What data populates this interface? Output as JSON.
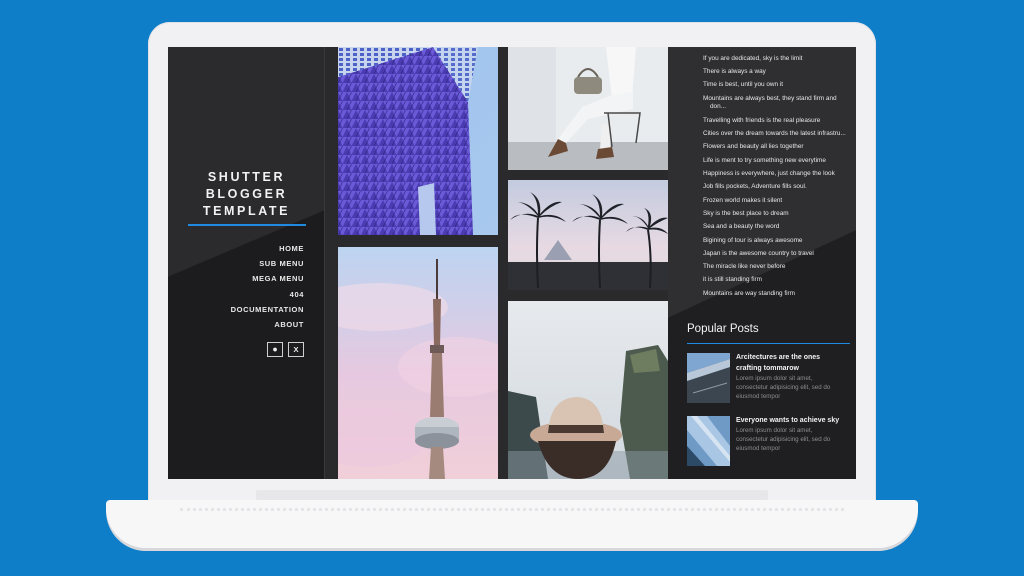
{
  "blog": {
    "title_line1": "SHUTTER",
    "title_line2": "BLOGGER",
    "title_line3": "TEMPLATE"
  },
  "menu": [
    {
      "label": "HOME"
    },
    {
      "label": "SUB MENU"
    },
    {
      "label": "MEGA MENU"
    },
    {
      "label": "404"
    },
    {
      "label": "DOCUMENTATION"
    },
    {
      "label": "ABOUT"
    }
  ],
  "social": {
    "icon1": "⏺",
    "icon2": "X"
  },
  "links": [
    "If you are dedicated, sky is the limit",
    "There is always a way",
    "Time is best, until you own it",
    "Mountains are always best, they stand firm and",
    "don...",
    "Travelling with friends is the real pleasure",
    "Cities over the dream towards the latest infrastru...",
    "Flowers and beauty all lies together",
    "Life is ment to try something new everytime",
    "Happiness is everywhere, just change the look",
    "Job fills pockets, Adventure fills soul.",
    "Frozen world makes it silent",
    "Sky is the best place to dream",
    "Sea and a beauty the word",
    "Bigining of tour is always awesome",
    "Japan is the awesome country to travel",
    "The miracle like never before",
    "it is still standing firm",
    "Mountains are way standing firm"
  ],
  "popular": {
    "heading": "Popular Posts",
    "posts": [
      {
        "title_line1": "Arcitectures are the ones",
        "title_line2": "crafting tommarow",
        "desc_line1": "Lorem ipsum dolor sit amet,",
        "desc_line2": "consectetur adipisicing elit, sed do",
        "desc_line3": "eiusmod tempor"
      },
      {
        "title_line1": "Everyone wants to achieve sky",
        "title_line2": "",
        "desc_line1": "Lorem ipsum dolor sit amet,",
        "desc_line2": "consectetur adipisicing elit, sed do",
        "desc_line3": "eiusmod tempor"
      }
    ]
  },
  "colors": {
    "background": "#0e7ec8",
    "accent": "#1e8be0",
    "sidebar": "#2b2b2d"
  }
}
